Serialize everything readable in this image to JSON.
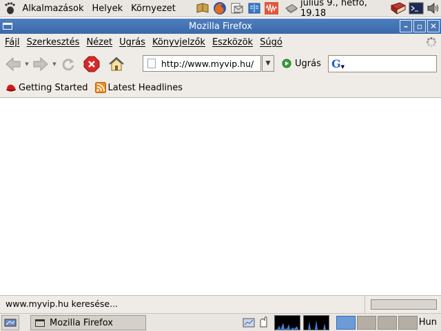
{
  "top_panel": {
    "menus": [
      "Alkalmazások",
      "Helyek",
      "Környezet"
    ],
    "launchers": [
      "help-browser-icon",
      "firefox-icon",
      "mail-icon",
      "dictionary-icon",
      "sound-recorder-icon"
    ],
    "clock": "július 9., hétfő, 19.18",
    "tray": [
      "book-icon",
      "terminal-icon",
      "volume-icon"
    ]
  },
  "window": {
    "title": "Mozilla Firefox"
  },
  "menubar": {
    "items": [
      "Fájl",
      "Szerkesztés",
      "Nézet",
      "Ugrás",
      "Könyvjelzők",
      "Eszközök",
      "Súgó"
    ]
  },
  "navbar": {
    "url": "http://www.myvip.hu/",
    "go_label": "Ugrás",
    "search_value": "",
    "search_engine": "G"
  },
  "bookmarks": {
    "items": [
      {
        "label": "Getting Started",
        "icon": "red-hat-icon"
      },
      {
        "label": "Latest Headlines",
        "icon": "rss-feed-icon"
      }
    ]
  },
  "statusbar": {
    "text": "www.myvip.hu keresése...",
    "progress": 0
  },
  "bottom_panel": {
    "task_label": "Mozilla Firefox",
    "workspaces": 4,
    "active_workspace": 1,
    "keyboard_layout": "Hun"
  },
  "colors": {
    "titlebar": "#3a69a8",
    "panel": "#e9e6e1",
    "toolbar": "#efebe7",
    "stop_red": "#d8282a"
  }
}
